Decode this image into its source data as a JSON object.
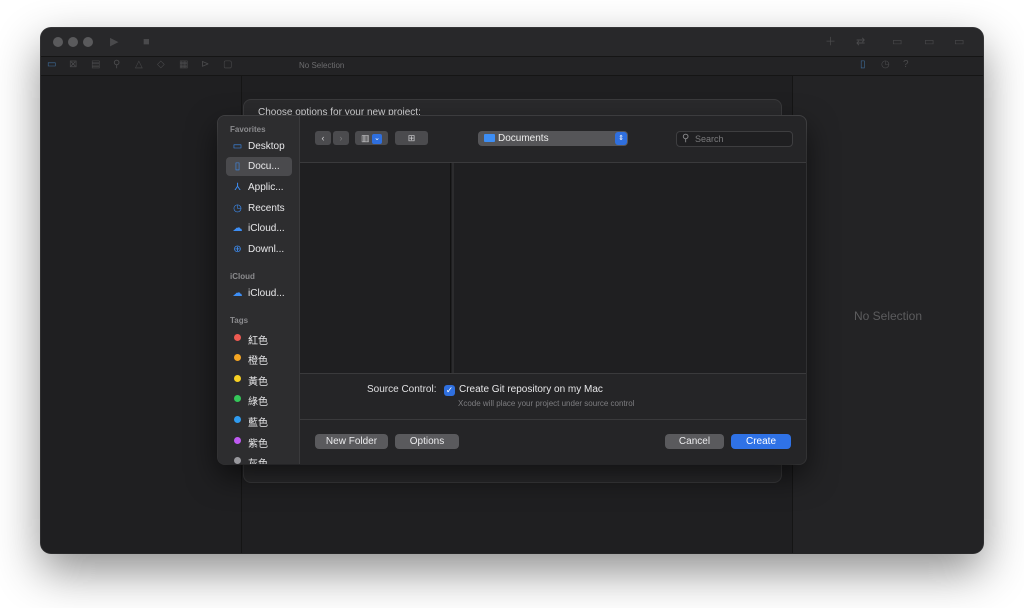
{
  "xcode": {
    "breadcrumb": "No Selection",
    "inspector_placeholder": "No Selection",
    "sheet_title": "Choose options for your new project:"
  },
  "dialog": {
    "sidebar": {
      "favorites_header": "Favorites",
      "favorites": [
        {
          "label": "Desktop",
          "icon": "desktop-icon"
        },
        {
          "label": "Docu...",
          "icon": "document-icon",
          "selected": true
        },
        {
          "label": "Applic...",
          "icon": "applications-icon"
        },
        {
          "label": "Recents",
          "icon": "clock-icon"
        },
        {
          "label": "iCloud...",
          "icon": "cloud-icon"
        },
        {
          "label": "Downl...",
          "icon": "download-icon"
        }
      ],
      "icloud_header": "iCloud",
      "icloud": [
        {
          "label": "iCloud...",
          "icon": "cloud-icon"
        }
      ],
      "tags_header": "Tags",
      "tags": [
        {
          "label": "紅色",
          "color": "#ee5a52"
        },
        {
          "label": "橙色",
          "color": "#f5a623"
        },
        {
          "label": "黃色",
          "color": "#f7d023"
        },
        {
          "label": "綠色",
          "color": "#34c759"
        },
        {
          "label": "藍色",
          "color": "#2f9bf0"
        },
        {
          "label": "紫色",
          "color": "#bf5af2"
        },
        {
          "label": "灰色",
          "color": "#98989d"
        }
      ]
    },
    "location": "Documents",
    "search_placeholder": "Search",
    "source_control_label": "Source Control:",
    "git_checkbox_label": "Create Git repository on my Mac",
    "git_checkbox_checked": true,
    "git_hint": "Xcode will place your project under source control",
    "buttons": {
      "new_folder": "New Folder",
      "options": "Options",
      "cancel": "Cancel",
      "create": "Create"
    }
  },
  "colors": {
    "accent": "#2f72e6"
  }
}
